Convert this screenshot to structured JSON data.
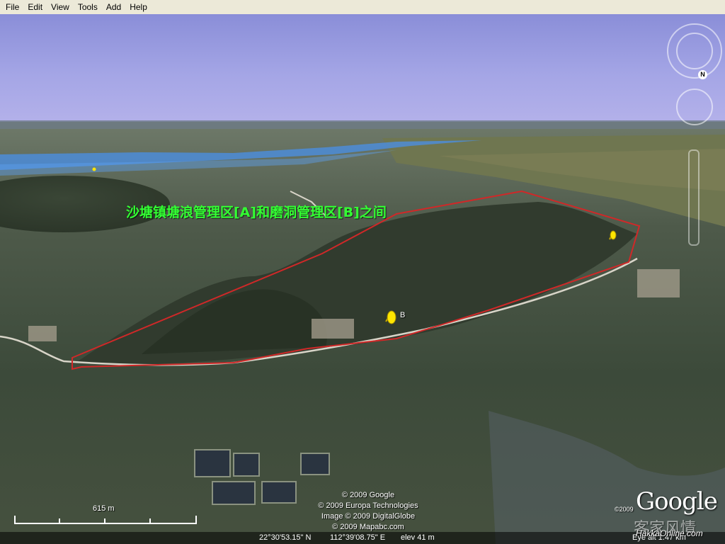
{
  "menu": [
    "File",
    "Edit",
    "View",
    "Tools",
    "Add",
    "Help"
  ],
  "overlay": {
    "caption": "沙塘镇塘浪管理区[A]和磨洞管理区[B]之间",
    "placemark_b_label": "B"
  },
  "attribution": [
    "© 2009 Google",
    "© 2009 Europa Technologies",
    "Image © 2009 DigitalGlobe",
    "© 2009 Mapabc.com"
  ],
  "scale": {
    "label": "615 m"
  },
  "status": {
    "latitude": "22°30'53.15\" N",
    "longitude": "112°39'08.75\" E",
    "elevation": "elev   41 m",
    "eye_alt": "Eye alt    1.47 km"
  },
  "branding": {
    "logo_text": "Google",
    "logo_year": "©2009",
    "watermark": "客家风情",
    "watermark_url": "HakkaOnline.com"
  },
  "compass": {
    "north_label": "N"
  },
  "colors": {
    "boundary": "#d02828",
    "caption": "#33ff33",
    "placemark": "#ffe600",
    "sky": "#a5a6e6",
    "river": "#4a90e8"
  }
}
